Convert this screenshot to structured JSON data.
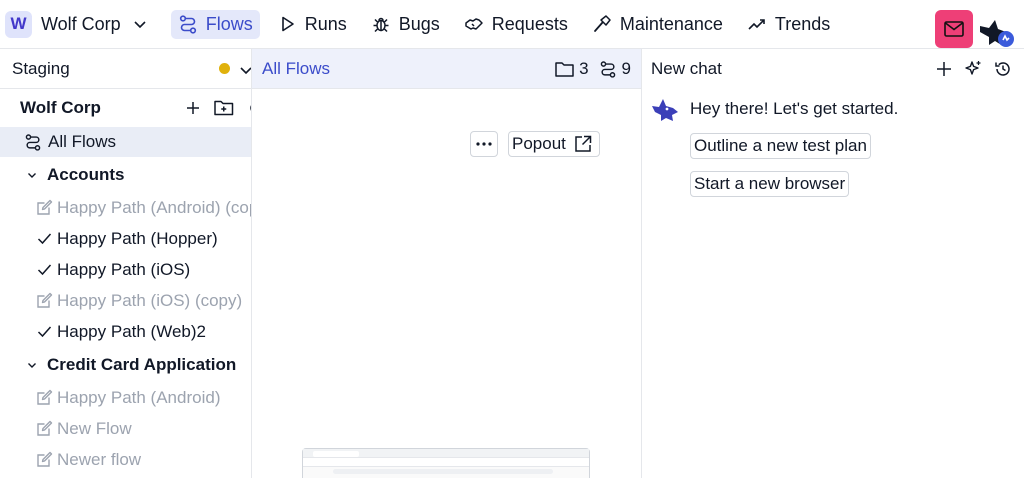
{
  "org": {
    "badge": "W",
    "name": "Wolf Corp"
  },
  "nav": {
    "items": [
      {
        "label": "Flows",
        "icon": "flows-icon",
        "active": true
      },
      {
        "label": "Runs",
        "icon": "play-icon",
        "active": false
      },
      {
        "label": "Bugs",
        "icon": "bug-icon",
        "active": false
      },
      {
        "label": "Requests",
        "icon": "handshake-icon",
        "active": false
      },
      {
        "label": "Maintenance",
        "icon": "hammer-icon",
        "active": false
      },
      {
        "label": "Trends",
        "icon": "trend-icon",
        "active": false
      }
    ]
  },
  "sidebar": {
    "environment": "Staging",
    "env_status_color": "#e0b10c",
    "org_title": "Wolf Corp",
    "all_flows": "All Flows",
    "folders": [
      {
        "name": "Accounts",
        "flows": [
          {
            "label": "Happy Path (Android) (copy)",
            "status": "draft"
          },
          {
            "label": "Happy Path (Hopper)",
            "status": "done"
          },
          {
            "label": "Happy Path (iOS)",
            "status": "done"
          },
          {
            "label": "Happy Path (iOS) (copy)",
            "status": "draft"
          },
          {
            "label": "Happy Path (Web)2",
            "status": "done"
          }
        ]
      },
      {
        "name": "Credit Card Application",
        "flows": [
          {
            "label": "Happy Path (Android)",
            "status": "draft"
          },
          {
            "label": "New Flow",
            "status": "draft"
          },
          {
            "label": "Newer flow",
            "status": "draft"
          }
        ]
      }
    ]
  },
  "main": {
    "title": "All Flows",
    "folder_count": "3",
    "flow_count": "9",
    "popout_label": "Popout"
  },
  "chat": {
    "title": "New chat",
    "greeting": "Hey there! Let's get started.",
    "suggestions": [
      "Outline a new test plan",
      "Start a new browser"
    ]
  },
  "colors": {
    "accent": "#3b4cca",
    "mail": "#ee3f77",
    "nav_active_bg": "#e4e8fa"
  }
}
